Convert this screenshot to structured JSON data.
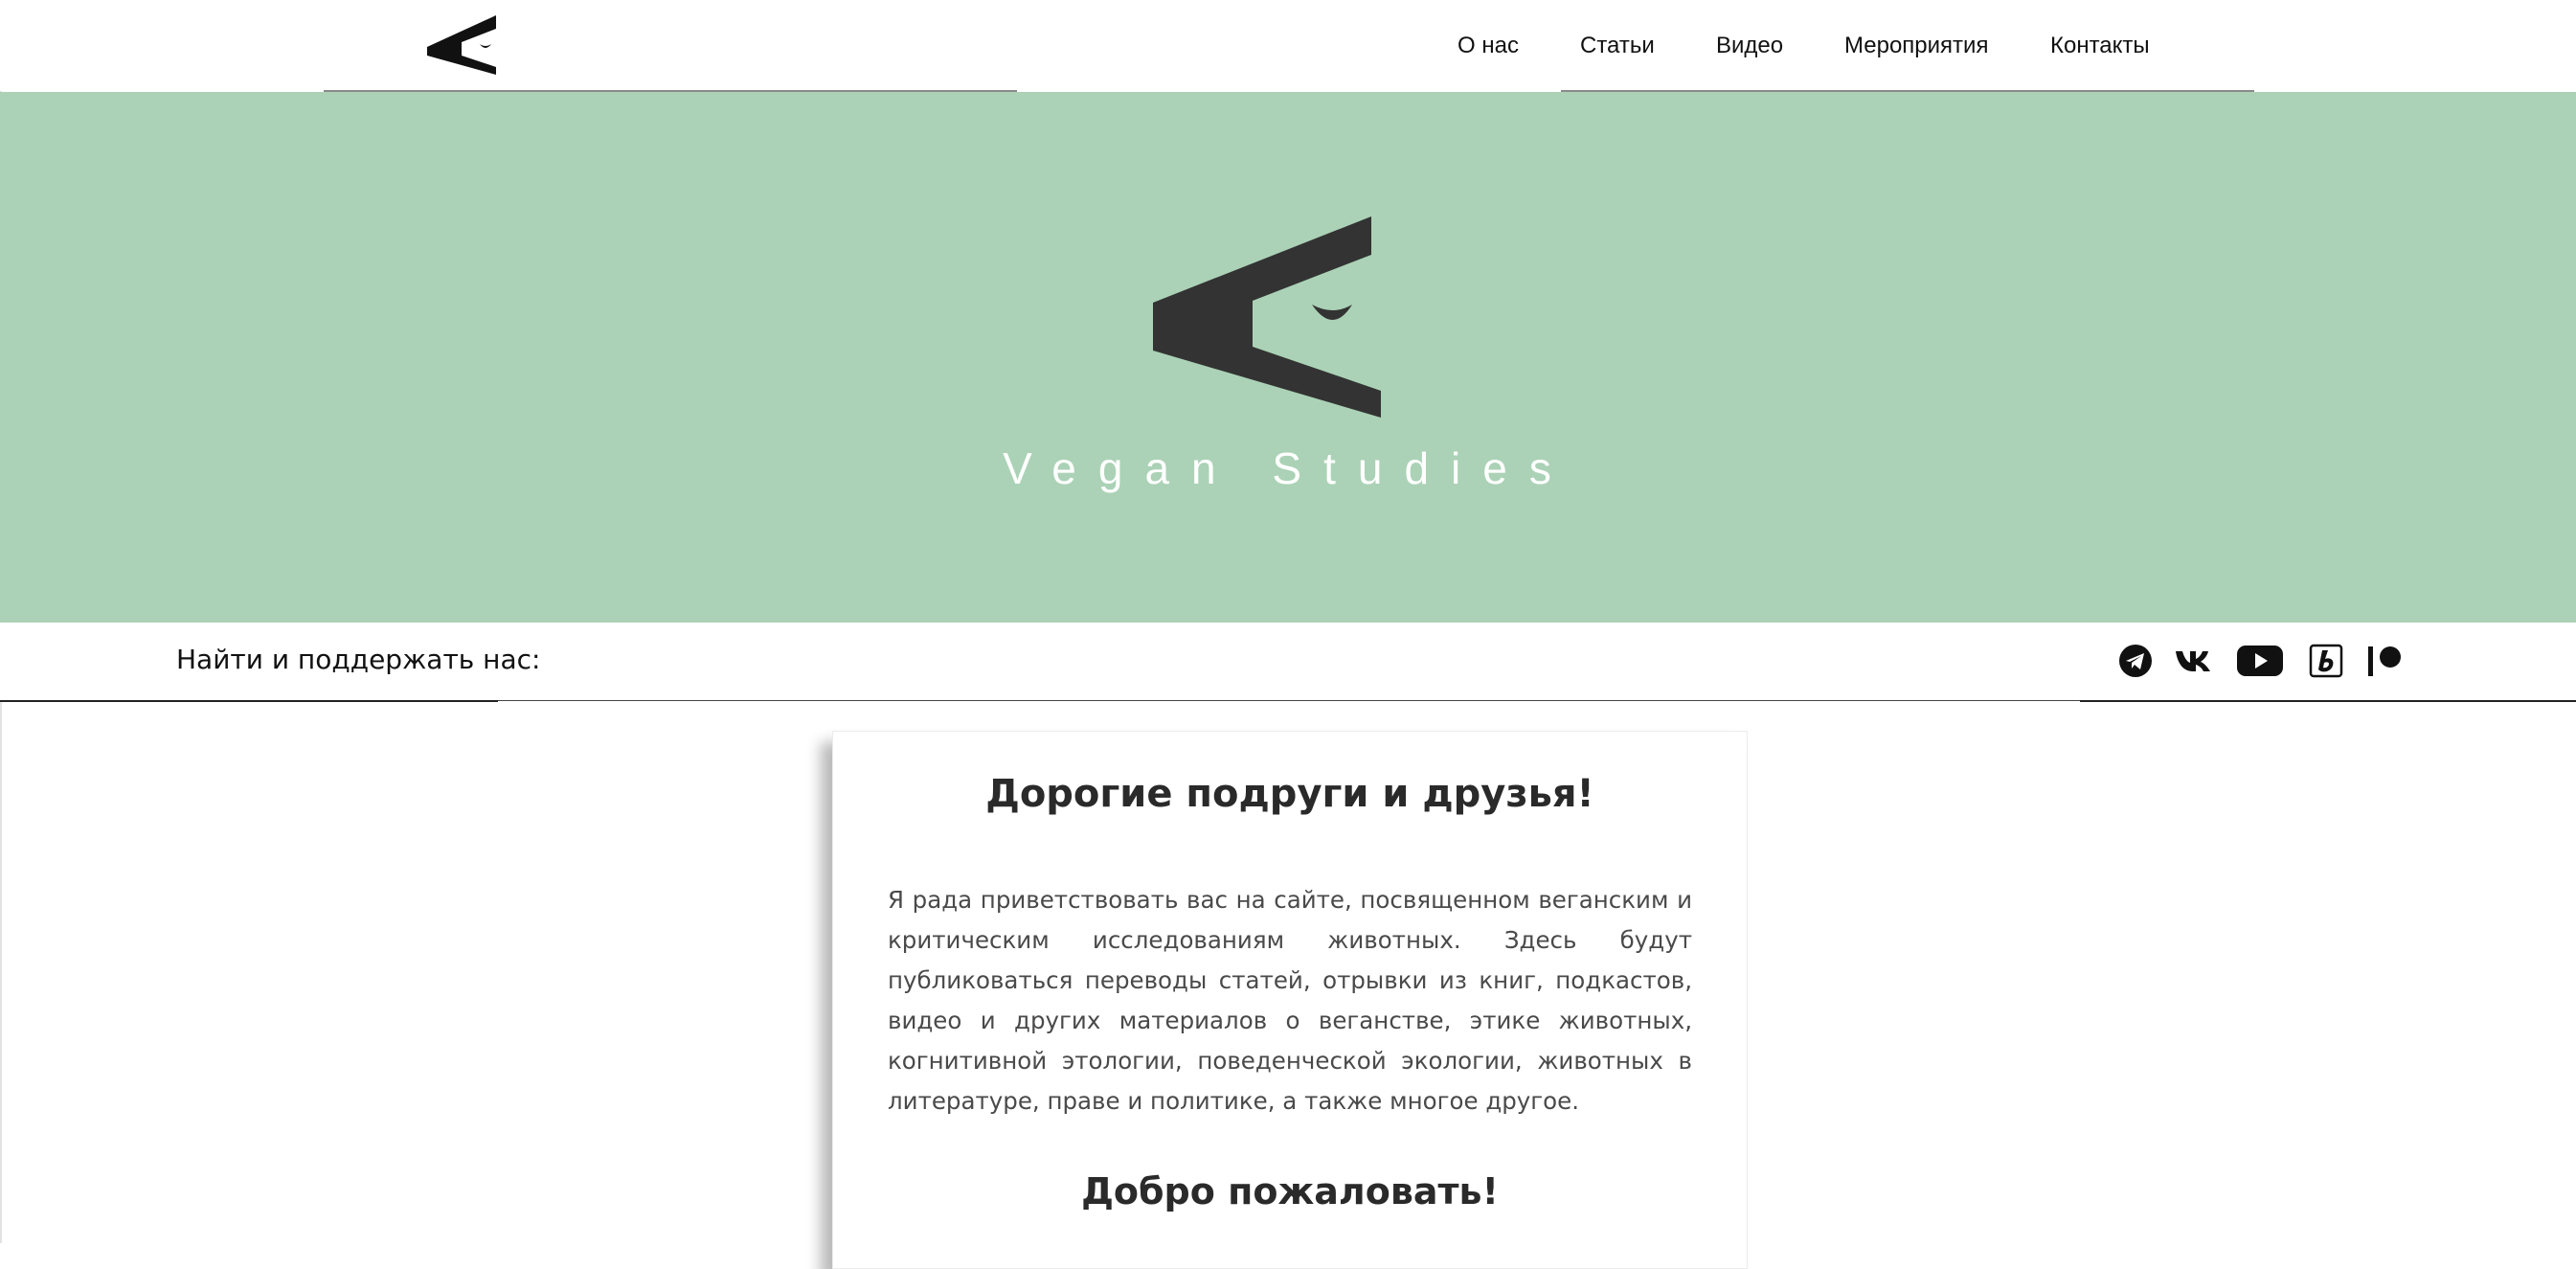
{
  "header": {
    "nav": [
      {
        "label": "О нас"
      },
      {
        "label": "Статьи"
      },
      {
        "label": "Видео"
      },
      {
        "label": "Мероприятия"
      },
      {
        "label": "Контакты"
      }
    ]
  },
  "hero": {
    "title": "Vegan Studies",
    "background_color": "#abd2b6"
  },
  "support": {
    "label": "Найти и поддержать нас:",
    "social_icons": [
      "telegram-icon",
      "vk-icon",
      "youtube-icon",
      "boosty-icon",
      "patreon-icon"
    ]
  },
  "card": {
    "title": "Дорогие подруги и друзья!",
    "text": "Я рада приветствовать вас на сайте, посвященном веганским и критическим исследованиям животных. Здесь будут публиковаться переводы статей, отрывки из книг, подкастов, видео и других материалов о веганстве, этике животных, когнитивной этологии, поведенческой экологии, животных в литературе, праве и политике, а также многое другое.",
    "subtitle": "Добро пожаловать!"
  }
}
